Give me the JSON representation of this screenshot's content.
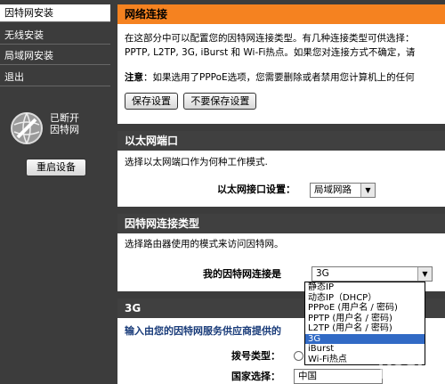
{
  "sidebar": {
    "items": [
      {
        "label": "因特网安装"
      },
      {
        "label": "无线安装"
      },
      {
        "label": "局域网安装"
      },
      {
        "label": "退出"
      }
    ],
    "status_line1": "已断开",
    "status_line2": "因特网",
    "reboot_label": "重启设备"
  },
  "wan": {
    "title": "网络连接",
    "desc_line1": "在这部分中可以配置您的因特网连接类型。有几种连接类型可供选择：",
    "desc_line2": "PPTP, L2TP, 3G, iBurst 和 Wi-Fi热点。如果您对连接方式不确定，请",
    "note_label": "注意",
    "note_text": "：如果选用了PPPoE选项，您需要删除或者禁用您计算机上的任何",
    "save_label": "保存设置",
    "nosave_label": "不要保存设置"
  },
  "ethernet": {
    "title": "以太网端口",
    "desc": "选择以太网端口作为何种工作模式.",
    "field_label": "以太网接口设置：",
    "field_value": "局域网路"
  },
  "conntype": {
    "title": "因特网连接类型",
    "desc": "选择路由器使用的模式来访问因特网。",
    "field_label": "我的因特网连接是",
    "field_value": "3G",
    "options": [
      "静态IP",
      "动态IP（DHCP）",
      "PPPoE (用户名 / 密码)",
      "PPTP (用户名 / 密码)",
      "L2TP (用户名 / 密码)",
      "3G",
      "iBurst",
      "Wi-Fi热点"
    ],
    "selected_index": 5
  },
  "g3": {
    "title": "3G",
    "subtitle": "输入由您的因特网服务供应商提供的",
    "dial_label": "拨号类型：",
    "country_label": "国家选择：",
    "country_value": "中国"
  },
  "watermark": "yesky"
}
